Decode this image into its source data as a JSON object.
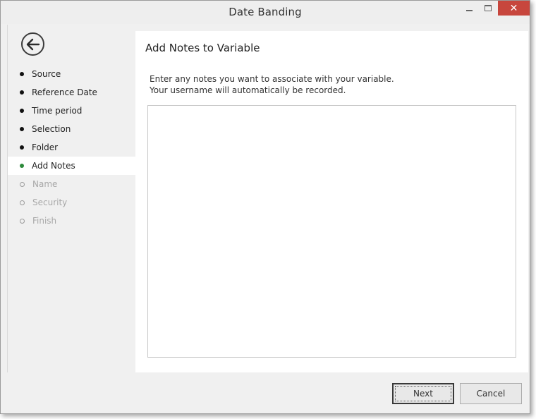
{
  "window": {
    "title": "Date Banding",
    "close_glyph": "✕"
  },
  "sidebar": {
    "back_icon": "back-arrow-icon",
    "steps": [
      {
        "label": "Source",
        "state": "done"
      },
      {
        "label": "Reference Date",
        "state": "done"
      },
      {
        "label": "Time period",
        "state": "done"
      },
      {
        "label": "Selection",
        "state": "done"
      },
      {
        "label": "Folder",
        "state": "done"
      },
      {
        "label": "Add Notes",
        "state": "current"
      },
      {
        "label": "Name",
        "state": "pending"
      },
      {
        "label": "Security",
        "state": "pending"
      },
      {
        "label": "Finish",
        "state": "pending"
      }
    ]
  },
  "main": {
    "title": "Add Notes to Variable",
    "description_line1": "Enter any notes you want to associate with your variable.",
    "description_line2": "Your username will automatically be recorded.",
    "notes_value": ""
  },
  "footer": {
    "next_label": "Next",
    "cancel_label": "Cancel"
  },
  "colors": {
    "current_step": "#2c8a3a",
    "close_button": "#c7463d"
  }
}
